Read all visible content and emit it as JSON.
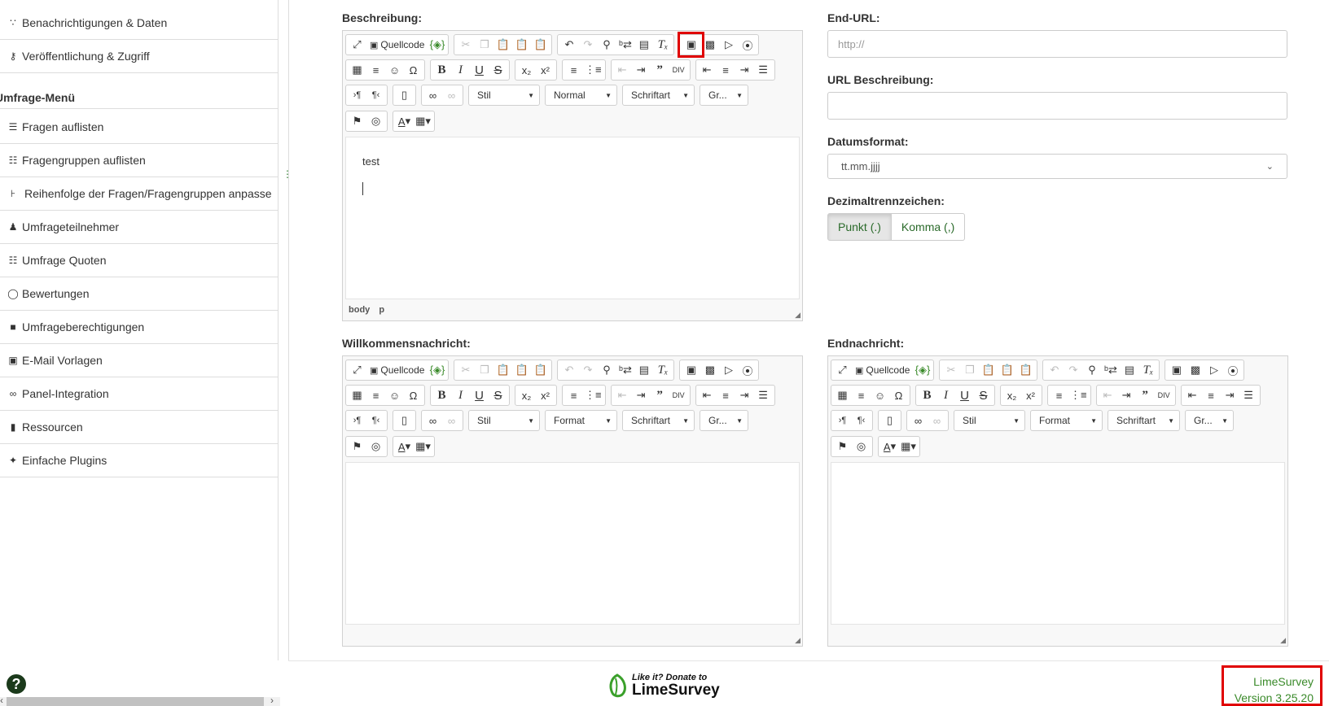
{
  "sidebar": {
    "items_top": [
      {
        "icon": "rss-icon",
        "glyph": "☰",
        "label": "Benachrichtigungen & Daten"
      },
      {
        "icon": "key-icon",
        "glyph": "⚿",
        "label": "Veröffentlichung & Zugriff"
      }
    ],
    "menu_heading": "Umfrage-Menü",
    "items": [
      {
        "icon": "list-icon",
        "glyph": "☰",
        "label": "Fragen auflisten"
      },
      {
        "icon": "th-list-icon",
        "glyph": "☷",
        "label": "Fragengruppen auflisten"
      },
      {
        "icon": "reorder-icon",
        "glyph": "⥮",
        "label": "Reihenfolge der Fragen/Fragengruppen anpasse"
      },
      {
        "icon": "user-icon",
        "glyph": "👤",
        "label": "Umfrageteilnehmer"
      },
      {
        "icon": "tasks-icon",
        "glyph": "☷",
        "label": "Umfrage Quoten"
      },
      {
        "icon": "comment-icon",
        "glyph": "💬",
        "label": "Bewertungen"
      },
      {
        "icon": "lock-icon",
        "glyph": "🔒",
        "label": "Umfrageberechtigungen"
      },
      {
        "icon": "envelope-icon",
        "glyph": "✉",
        "label": "E-Mail Vorlagen"
      },
      {
        "icon": "link-icon",
        "glyph": "🔗",
        "label": "Panel-Integration"
      },
      {
        "icon": "file-icon",
        "glyph": "📄",
        "label": "Ressourcen"
      },
      {
        "icon": "plug-icon",
        "glyph": "🔌",
        "label": "Einfache Plugins"
      }
    ]
  },
  "labels": {
    "description": "Beschreibung:",
    "welcome": "Willkommensnachricht:",
    "end_message": "Endnachricht:",
    "end_url": "End-URL:",
    "url_description": "URL Beschreibung:",
    "date_format": "Datumsformat:",
    "decimal": "Dezimaltrennzeichen:"
  },
  "editor": {
    "source_label": "Quellcode",
    "style_combo": "Stil",
    "format_combo_active": "Normal",
    "format_combo": "Format",
    "font_combo": "Schriftart",
    "size_combo": "Gr...",
    "content_text": "test",
    "path_body": "body",
    "path_p": "p"
  },
  "form": {
    "end_url_placeholder": "http://",
    "url_description_value": "",
    "date_format_value": "tt.mm.jjjj",
    "decimal_options": [
      "Punkt (.)",
      "Komma (,)"
    ],
    "decimal_selected": "Punkt (.)"
  },
  "footer": {
    "donate_line1": "Like it? Donate to",
    "donate_line2": "LimeSurvey",
    "product": "LimeSurvey",
    "version": "Version 3.25.20"
  },
  "colors": {
    "highlight": "#e00000",
    "accent_green": "#3a8a2a"
  }
}
